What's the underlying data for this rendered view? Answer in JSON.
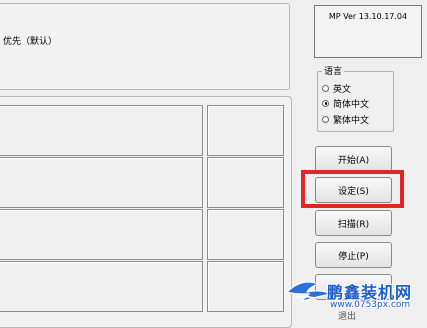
{
  "info": {
    "text": "优先（默认）"
  },
  "version": {
    "text": "MP Ver 13.10.17.04"
  },
  "language": {
    "title": "语言",
    "options": [
      {
        "label": "英文",
        "selected": false
      },
      {
        "label": "简体中文",
        "selected": true
      },
      {
        "label": "繁体中文",
        "selected": false
      }
    ]
  },
  "buttons": {
    "start": "开始(A)",
    "settings": "设定(S)",
    "scan": "扫描(R)",
    "stop": "停止(P)",
    "partial": "退出"
  },
  "highlight_color": "#e02626",
  "watermark": {
    "title": "鹏鑫装机网",
    "url": "www.0753px.com",
    "color": "#1d5ec9"
  }
}
